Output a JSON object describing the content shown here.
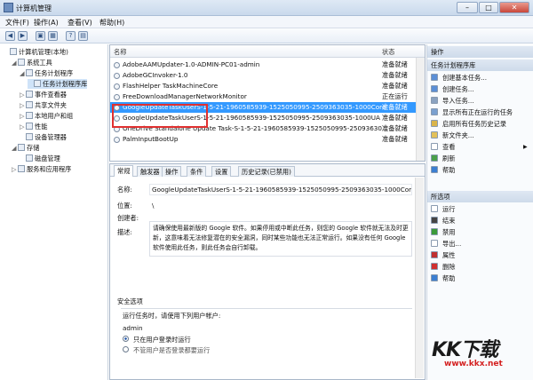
{
  "window": {
    "title": "计算机管理",
    "btn_min": "–",
    "btn_max": "□",
    "btn_close": "✕"
  },
  "menu": [
    "文件(F)",
    "操作(A)",
    "查看(V)",
    "帮助(H)"
  ],
  "toolbar": {
    "icons": [
      "back-icon",
      "forward-icon",
      "folder-icon",
      "grid-icon",
      "help-icon",
      "panel-icon"
    ],
    "glyphs": [
      "◀",
      "▶",
      "▣",
      "▦",
      "?",
      "▤"
    ]
  },
  "tree": [
    {
      "label": "计算机管理(本地)",
      "depth": 0,
      "toggle": "",
      "icon": "computer-icon"
    },
    {
      "label": "系统工具",
      "depth": 1,
      "toggle": "◢",
      "icon": "tools-icon"
    },
    {
      "label": "任务计划程序",
      "depth": 2,
      "toggle": "◢",
      "icon": "clock-icon"
    },
    {
      "label": "任务计划程序库",
      "depth": 3,
      "toggle": "",
      "icon": "folder-icon",
      "selected": true
    },
    {
      "label": "事件查看器",
      "depth": 2,
      "toggle": "▷",
      "icon": "event-icon"
    },
    {
      "label": "共享文件夹",
      "depth": 2,
      "toggle": "▷",
      "icon": "share-icon"
    },
    {
      "label": "本地用户和组",
      "depth": 2,
      "toggle": "▷",
      "icon": "users-icon"
    },
    {
      "label": "性能",
      "depth": 2,
      "toggle": "▷",
      "icon": "performance-icon"
    },
    {
      "label": "设备管理器",
      "depth": 2,
      "toggle": "",
      "icon": "device-icon"
    },
    {
      "label": "存储",
      "depth": 1,
      "toggle": "◢",
      "icon": "storage-icon"
    },
    {
      "label": "磁盘管理",
      "depth": 2,
      "toggle": "",
      "icon": "disk-icon"
    },
    {
      "label": "服务和应用程序",
      "depth": 1,
      "toggle": "▷",
      "icon": "services-icon"
    }
  ],
  "tasklist": {
    "col_name": "名称",
    "col_status": "状态",
    "rows": [
      {
        "name": "AdobeAAMUpdater-1.0-ADMIN-PC01-admin",
        "status": "准备就绪"
      },
      {
        "name": "AdobeGCInvoker-1.0",
        "status": "准备就绪"
      },
      {
        "name": "FlashHelper TaskMachineCore",
        "status": "准备就绪"
      },
      {
        "name": "FreeDownloadManagerNetworkMonitor",
        "status": "正在运行"
      },
      {
        "name": "GoogleUpdateTaskUserS-1-5-21-1960585939-1525050995-2509363035-1000Core",
        "status": "准备就绪",
        "selected": true
      },
      {
        "name": "GoogleUpdateTaskUserS-1-5-21-1960585939-1525050995-2509363035-1000UA",
        "status": "准备就绪"
      },
      {
        "name": "OneDrive Standalone Update Task-S-1-5-21-1960585939-1525050995-25093630...",
        "status": "准备就绪"
      },
      {
        "name": "PalmInputBootUp",
        "status": "准备就绪"
      }
    ]
  },
  "detail": {
    "tabs": [
      "常规",
      "触发器",
      "操作",
      "条件",
      "设置",
      "历史记录(已禁用)"
    ],
    "name_label": "名称:",
    "name_value": "GoogleUpdateTaskUserS-1-5-21-1960585939-1525050995-2509363035-1000Core",
    "location_label": "位置:",
    "location_value": "\\",
    "author_label": "创建者:",
    "desc_label": "描述:",
    "desc_value": "请确保使用最新版的 Google 软件。如果停用或中断此任务，则您的 Google 软件就无法及时更新，这意味着无法修复潜在的安全漏洞，同时某些功能也无法正常运行。如果没有任何 Google 软件使用此任务，则此任务会自行卸载。",
    "security_label": "安全选项",
    "run_as_label": "运行任务时，请使用下列用户帐户:",
    "run_as_value": "admin",
    "radio1": "只在用户登录时运行",
    "radio2": "不管用户是否登录都要运行"
  },
  "actions": {
    "header1": "操作",
    "section1": "任务计划程序库",
    "items1": [
      {
        "label": "创建基本任务...",
        "icon": "create-basic-task-icon",
        "color": "#5b8fd6"
      },
      {
        "label": "创建任务...",
        "icon": "create-task-icon",
        "color": "#5b8fd6"
      },
      {
        "label": "导入任务...",
        "icon": "import-icon",
        "color": "#8aa2c0"
      },
      {
        "label": "显示所有正在运行的任务",
        "icon": "running-tasks-icon",
        "color": "#7aa0cf"
      },
      {
        "label": "启用所有任务历史记录",
        "icon": "history-icon",
        "color": "#d9b44a"
      },
      {
        "label": "新文件夹...",
        "icon": "new-folder-icon",
        "color": "#e3c15a"
      },
      {
        "label": "查看",
        "icon": "view-icon",
        "color": "#ffffff",
        "arrow": "▶"
      },
      {
        "label": "刷新",
        "icon": "refresh-icon",
        "color": "#4aa04a"
      },
      {
        "label": "帮助",
        "icon": "help-icon",
        "color": "#3c7fd1"
      }
    ],
    "section2": "所选项",
    "items2": [
      {
        "label": "运行",
        "icon": "run-icon",
        "color": "#ffffff"
      },
      {
        "label": "结束",
        "icon": "stop-icon",
        "color": "#444444"
      },
      {
        "label": "禁用",
        "icon": "disable-icon",
        "color": "#3a9a3a"
      },
      {
        "label": "导出...",
        "icon": "export-icon",
        "color": "#ffffff"
      },
      {
        "label": "属性",
        "icon": "properties-icon",
        "color": "#c03030"
      },
      {
        "label": "删除",
        "icon": "delete-icon",
        "color": "#d03030"
      },
      {
        "label": "帮助",
        "icon": "help-icon",
        "color": "#3c7fd1"
      }
    ]
  },
  "watermark": {
    "big": "KK下载",
    "small": "www.kkx.net"
  },
  "colors": {
    "selection": "#3399ff",
    "highlight_box": "#e03030"
  }
}
